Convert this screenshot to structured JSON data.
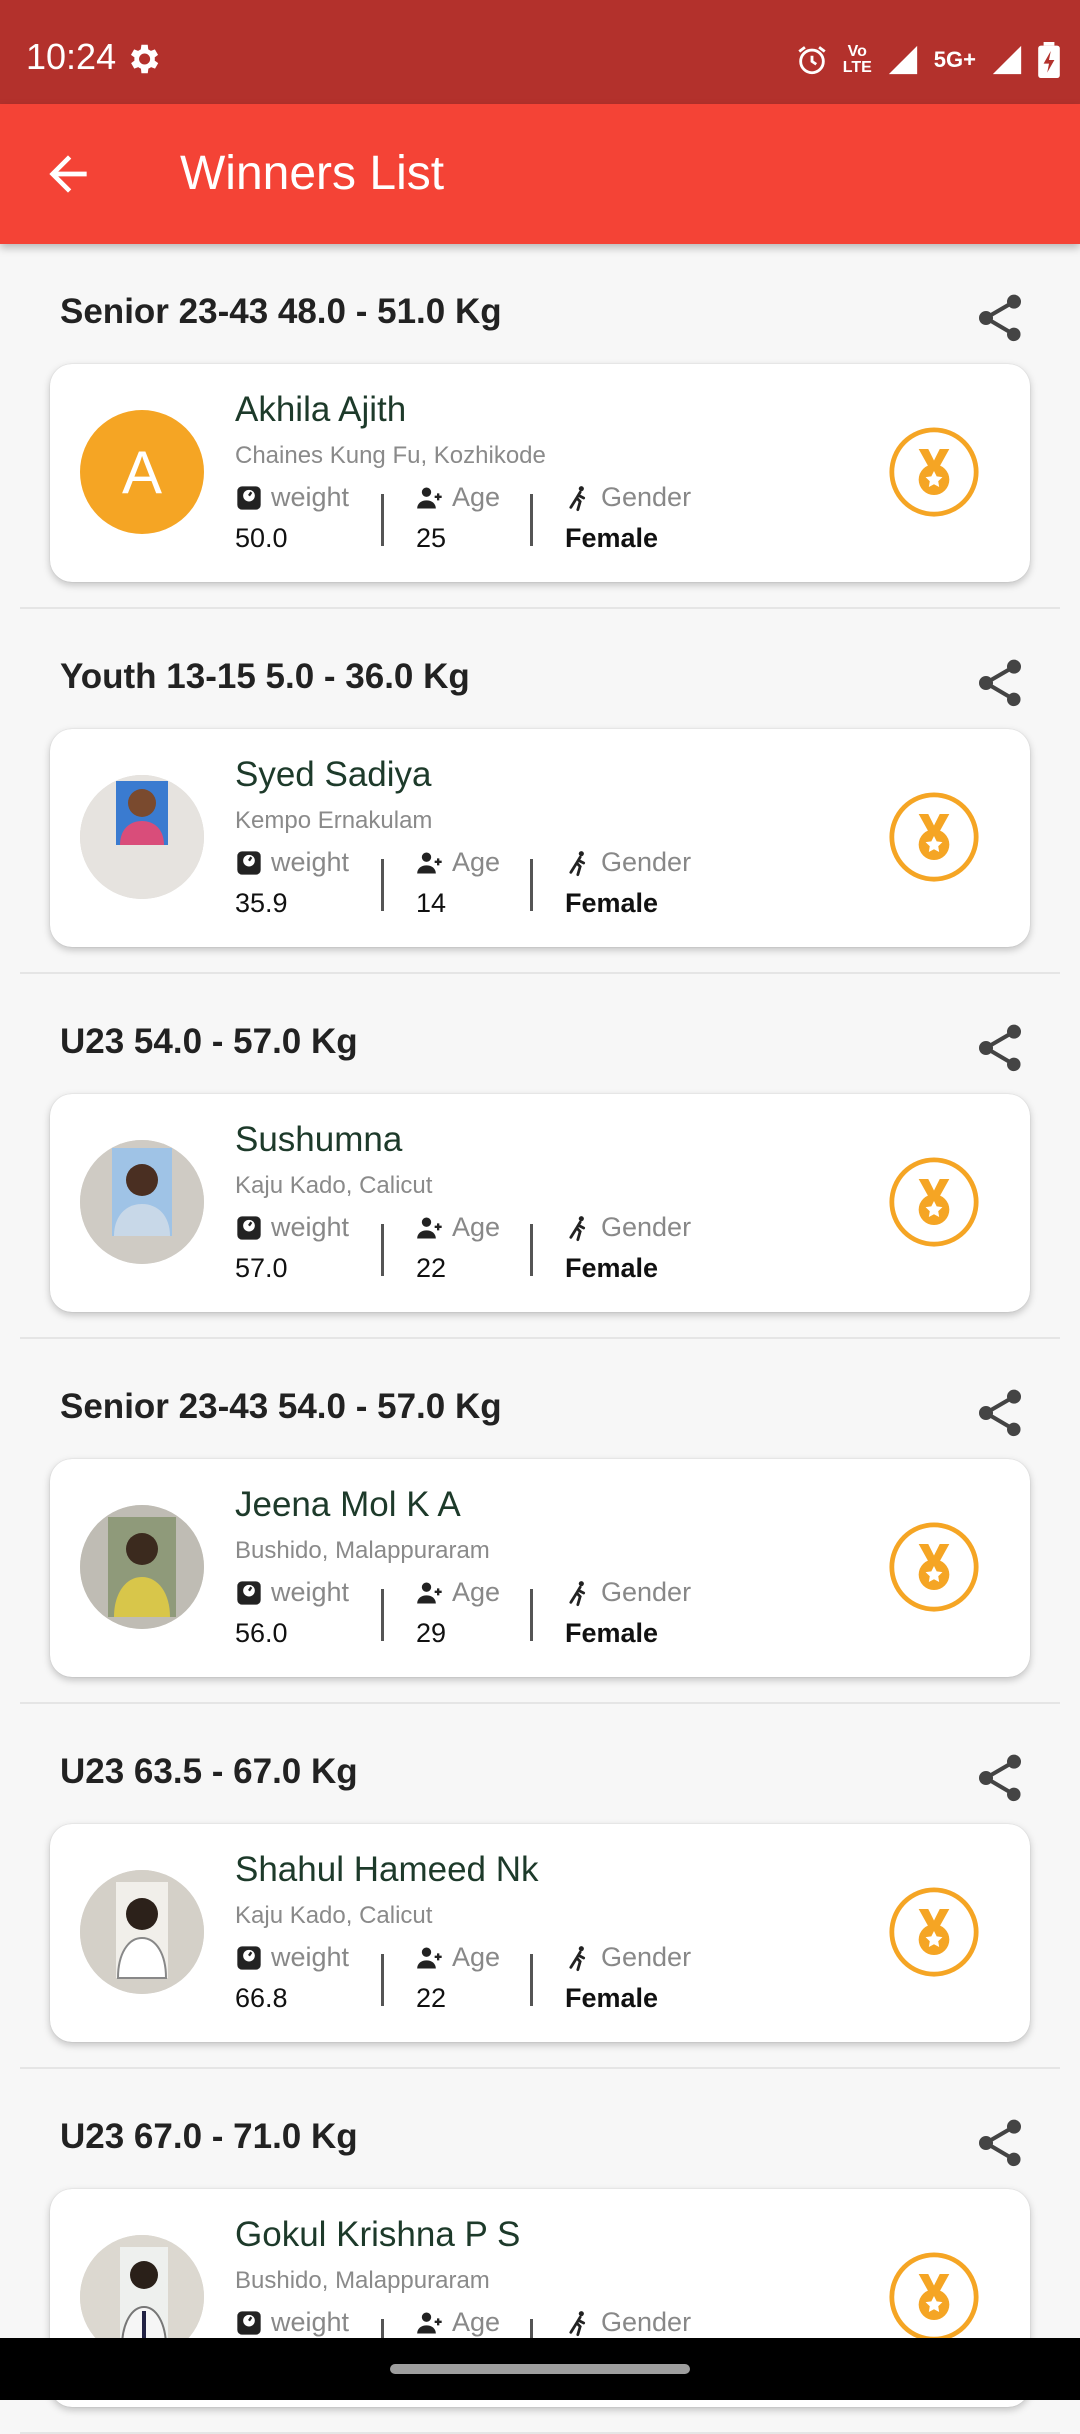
{
  "status_bar": {
    "time": "10:24",
    "volte_line1": "Vo",
    "volte_line2": "LTE",
    "network": "5G+",
    "icons": [
      "gear-icon",
      "alarm-icon",
      "volte-icon",
      "signal-icon",
      "signal-5g-icon",
      "battery-charging-icon"
    ]
  },
  "app_bar": {
    "title": "Winners List",
    "back_icon": "arrow-left-icon",
    "background": "#f44336"
  },
  "labels": {
    "weight": "weight",
    "age": "Age",
    "gender": "Gender"
  },
  "colors": {
    "status_bar": "#b3312c",
    "medal": "#f5a524",
    "avatar_letter_bg": "#f5a524"
  },
  "winners": [
    {
      "category": "Senior 23-43 48.0 - 51.0 Kg",
      "name": "Akhila Ajith",
      "club": "Chaines Kung Fu, Kozhikode",
      "weight": "50.0",
      "age": "25",
      "gender": "Female",
      "avatar_letter": "A"
    },
    {
      "category": "Youth 13-15 5.0 - 36.0 Kg",
      "name": "Syed Sadiya",
      "club": "Kempo Ernakulam",
      "weight": "35.9",
      "age": "14",
      "gender": "Female"
    },
    {
      "category": "U23 54.0 - 57.0 Kg",
      "name": "Sushumna",
      "club": "Kaju Kado, Calicut",
      "weight": "57.0",
      "age": "22",
      "gender": "Female"
    },
    {
      "category": "Senior 23-43 54.0 - 57.0 Kg",
      "name": "Jeena Mol K A",
      "club": "Bushido, Malappuraram",
      "weight": "56.0",
      "age": "29",
      "gender": "Female"
    },
    {
      "category": "U23 63.5 - 67.0 Kg",
      "name": "Shahul Hameed Nk",
      "club": "Kaju Kado, Calicut",
      "weight": "66.8",
      "age": "22",
      "gender": "Female"
    },
    {
      "category": "U23 67.0 - 71.0 Kg",
      "name": "Gokul Krishna P S",
      "club": "Bushido, Malappuraram",
      "weight": "",
      "age": "",
      "gender": ""
    }
  ]
}
